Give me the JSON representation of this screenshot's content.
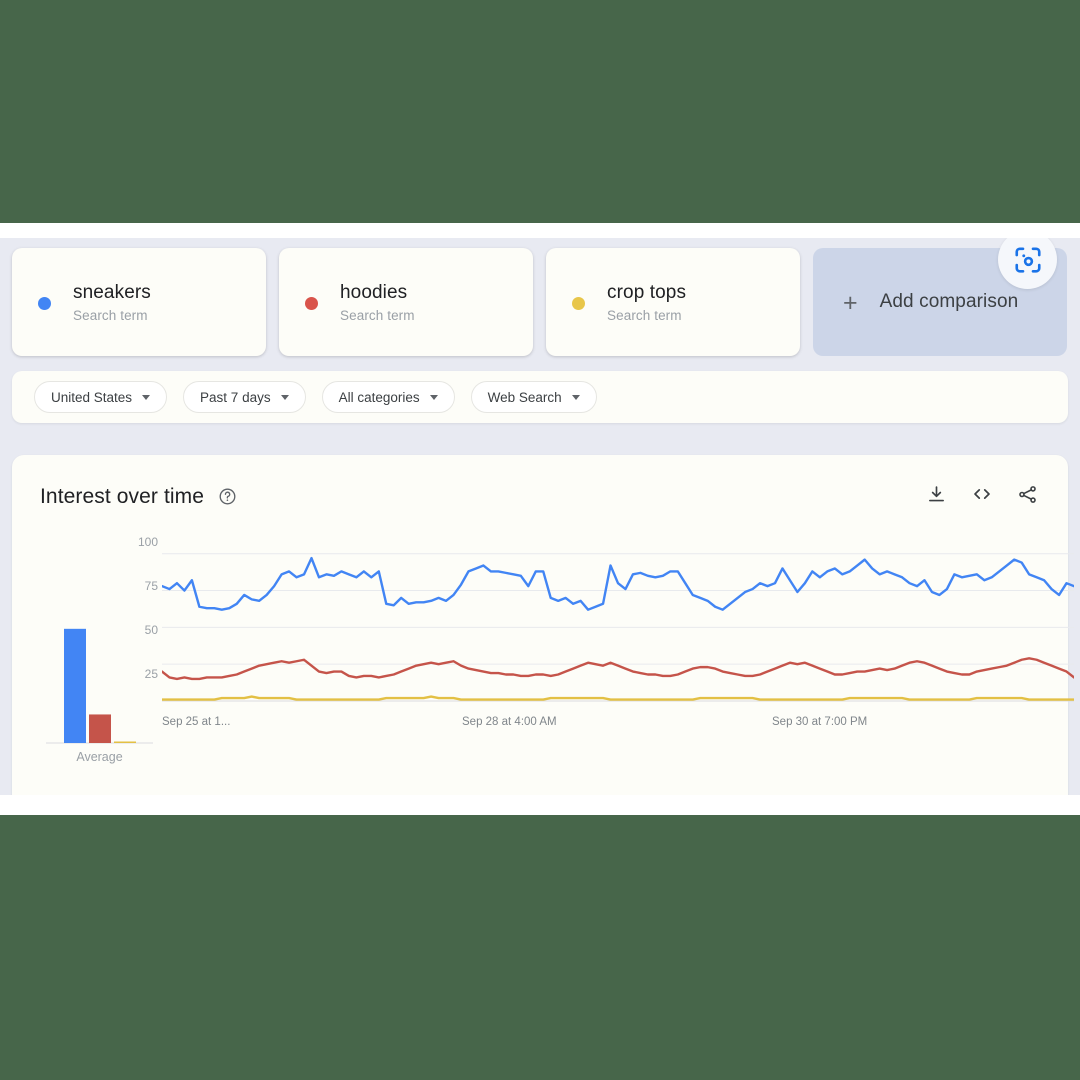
{
  "frame": {
    "backdrop_color": "#47664a",
    "page_bg": "#e8eaf2"
  },
  "comparison": {
    "terms": [
      {
        "name": "sneakers",
        "subtitle": "Search term",
        "color": "#4285f4"
      },
      {
        "name": "hoodies",
        "subtitle": "Search term",
        "color": "#d9544b"
      },
      {
        "name": "crop tops",
        "subtitle": "Search term",
        "color": "#e8c64a"
      }
    ],
    "add_label": "Add comparison",
    "add_plus": "+",
    "lens_icon": "google-lens-icon"
  },
  "filters": [
    {
      "label": "United States"
    },
    {
      "label": "Past 7 days"
    },
    {
      "label": "All categories"
    },
    {
      "label": "Web Search"
    }
  ],
  "chart_card": {
    "title": "Interest over time",
    "help_icon": "help-circle-icon",
    "actions": [
      {
        "name": "download-icon"
      },
      {
        "name": "embed-code-icon"
      },
      {
        "name": "share-icon"
      }
    ]
  },
  "chart_data": {
    "type": "line",
    "title": "Interest over time",
    "xlabel": "",
    "ylabel": "",
    "ylim": [
      0,
      110
    ],
    "yticks": [
      25,
      50,
      75,
      100
    ],
    "ytick_labels": [
      "25",
      "50",
      "75",
      "100"
    ],
    "grid": true,
    "legend_position": "top-cards",
    "x_tick_labels": [
      "Sep 25 at 1...",
      "Sep 28 at 4:00 AM",
      "Sep 30 at 7:00 PM"
    ],
    "x_tick_positions": [
      0.02,
      0.45,
      0.82
    ],
    "average_panel": {
      "label": "Average",
      "values": [
        80,
        20,
        1
      ]
    },
    "series": [
      {
        "name": "sneakers",
        "color": "#4285f4",
        "values": [
          78,
          76,
          80,
          75,
          82,
          64,
          63,
          63,
          62,
          63,
          66,
          72,
          69,
          68,
          72,
          78,
          86,
          88,
          84,
          86,
          97,
          84,
          86,
          85,
          88,
          86,
          84,
          88,
          84,
          88,
          66,
          65,
          70,
          66,
          67,
          67,
          68,
          70,
          68,
          72,
          79,
          88,
          90,
          92,
          88,
          88,
          87,
          86,
          85,
          78,
          88,
          88,
          70,
          68,
          70,
          66,
          68,
          62,
          64,
          66,
          92,
          80,
          76,
          86,
          87,
          85,
          84,
          85,
          88,
          88,
          80,
          72,
          70,
          68,
          64,
          62,
          66,
          70,
          74,
          76,
          80,
          78,
          80,
          90,
          82,
          74,
          80,
          88,
          84,
          88,
          90,
          86,
          88,
          92,
          96,
          90,
          86,
          88,
          86,
          84,
          80,
          78,
          82,
          74,
          72,
          76,
          86,
          84,
          85,
          86,
          82,
          84,
          88,
          92,
          96,
          94,
          86,
          84,
          82,
          76,
          72,
          80,
          78
        ]
      },
      {
        "name": "hoodies",
        "color": "#c5544a",
        "values": [
          20,
          16,
          15,
          16,
          15,
          15,
          16,
          16,
          16,
          17,
          18,
          20,
          22,
          24,
          25,
          26,
          27,
          26,
          27,
          28,
          24,
          20,
          19,
          20,
          20,
          17,
          16,
          17,
          17,
          16,
          17,
          18,
          20,
          22,
          24,
          25,
          26,
          25,
          26,
          27,
          24,
          22,
          21,
          20,
          19,
          19,
          18,
          18,
          17,
          17,
          18,
          18,
          17,
          18,
          20,
          22,
          24,
          26,
          25,
          24,
          26,
          24,
          22,
          20,
          19,
          18,
          18,
          17,
          17,
          18,
          20,
          22,
          23,
          23,
          22,
          20,
          19,
          18,
          17,
          17,
          18,
          20,
          22,
          24,
          26,
          25,
          26,
          24,
          22,
          20,
          18,
          18,
          19,
          20,
          20,
          21,
          22,
          21,
          22,
          24,
          26,
          27,
          26,
          24,
          22,
          20,
          19,
          18,
          18,
          20,
          21,
          22,
          23,
          24,
          26,
          28,
          29,
          28,
          26,
          24,
          22,
          20,
          16
        ]
      },
      {
        "name": "crop tops",
        "color": "#e3c044",
        "values": [
          1,
          1,
          1,
          1,
          1,
          1,
          1,
          1,
          2,
          2,
          2,
          2,
          3,
          2,
          2,
          2,
          2,
          2,
          1,
          1,
          1,
          1,
          1,
          1,
          1,
          1,
          1,
          1,
          1,
          1,
          2,
          2,
          2,
          2,
          2,
          2,
          3,
          2,
          2,
          2,
          1,
          1,
          1,
          1,
          1,
          1,
          1,
          1,
          1,
          1,
          1,
          1,
          2,
          2,
          2,
          2,
          2,
          2,
          2,
          2,
          1,
          1,
          1,
          1,
          1,
          1,
          1,
          1,
          1,
          1,
          1,
          1,
          2,
          2,
          2,
          2,
          2,
          2,
          2,
          2,
          1,
          1,
          1,
          1,
          1,
          1,
          1,
          1,
          1,
          1,
          1,
          1,
          2,
          2,
          2,
          2,
          2,
          2,
          2,
          2,
          1,
          1,
          1,
          1,
          1,
          1,
          1,
          1,
          1,
          2,
          2,
          2,
          2,
          2,
          2,
          2,
          1,
          1,
          1,
          1,
          1,
          1,
          1
        ]
      }
    ]
  }
}
